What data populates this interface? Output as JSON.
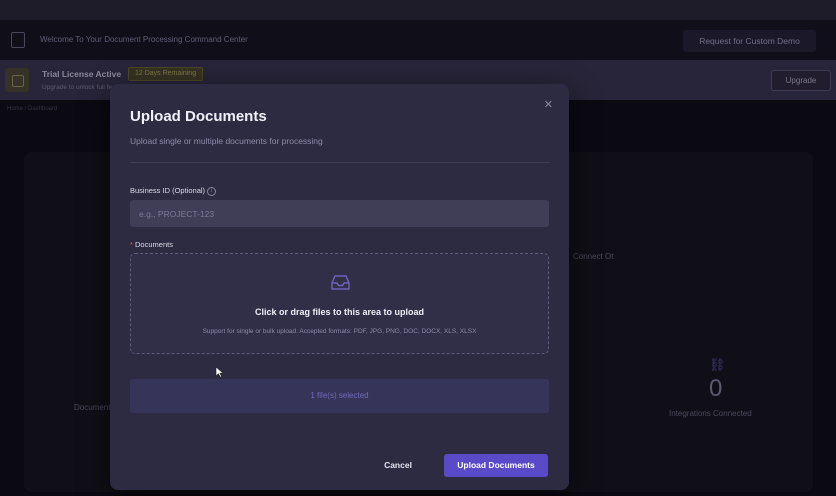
{
  "header": {
    "title": "Welcome To Your Document Processing Command Center",
    "demo_button": "Request for Custom Demo"
  },
  "license": {
    "title": "Trial License Active",
    "badge": "12 Days Remaining",
    "subtitle": "Upgrade to unlock full features",
    "upgrade_button": "Upgrade"
  },
  "breadcrumb": "Home / Dashboard",
  "background": {
    "stat_left_label": "Documents",
    "stat_right_label": "Integrations Connected",
    "stat_right_value": "0",
    "side_text": "Connect Ot"
  },
  "modal": {
    "title": "Upload Documents",
    "subtitle": "Upload single or multiple documents for processing",
    "close_icon": "close-icon",
    "business_id_label": "Business ID (Optional)",
    "business_id_placeholder": "e.g., PROJECT-123",
    "business_id_value": "",
    "documents_required_mark": "*",
    "documents_label": "Documents",
    "dropzone_text": "Click or drag files to this area to upload",
    "dropzone_hint": "Support for single or bulk upload. Accepted formats: PDF, JPG, PNG, DOC, DOCX, XLS, XLSX",
    "files_selected": "1 file(s) selected",
    "cancel_button": "Cancel",
    "upload_button": "Upload Documents"
  },
  "colors": {
    "accent": "#5b4ac8",
    "modal_bg": "#2d2b41",
    "license_bar": "#3a3550",
    "badge": "#4d4a2c"
  }
}
